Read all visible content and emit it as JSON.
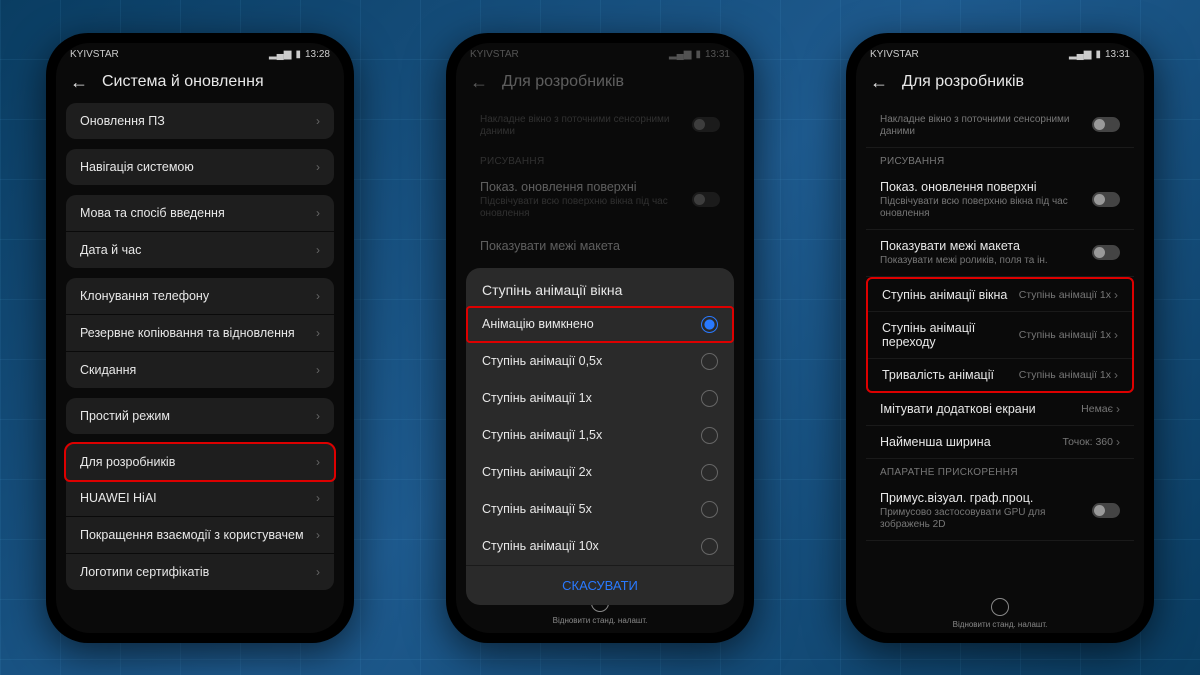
{
  "statusbar": {
    "carrier": "KYIVSTAR",
    "time1": "13:28",
    "time2": "13:31",
    "time3": "13:31"
  },
  "screen1": {
    "title": "Система й оновлення",
    "items": {
      "update": "Оновлення ПЗ",
      "nav": "Навігація системою",
      "lang": "Мова та спосіб введення",
      "date": "Дата й час",
      "clone": "Клонування телефону",
      "backup": "Резервне копіювання та відновлення",
      "reset": "Скидання",
      "simple": "Простий режим",
      "dev": "Для розробників",
      "hiai": "HUAWEI HiAI",
      "ux": "Покращення взаємодії з користувачем",
      "cert": "Логотипи сертифікатів"
    }
  },
  "screen2": {
    "title": "Для розробників",
    "overlay_desc": "Накладне вікно з поточними сенсорними даними",
    "section_draw": "РИСУВАННЯ",
    "surf_title": "Показ. оновлення поверхні",
    "surf_desc": "Підсвічувати всю поверхню вікна під час оновлення",
    "layout_title": "Показувати межі макета",
    "dialog_title": "Ступінь анімації вікна",
    "radios": [
      "Анімацію вимкнено",
      "Ступінь анімації 0,5x",
      "Ступінь анімації 1x",
      "Ступінь анімації 1,5x",
      "Ступінь анімації 2x",
      "Ступінь анімації 5x",
      "Ступінь анімації 10x"
    ],
    "cancel": "СКАСУВАТИ",
    "nav_label": "Відновити станд. налашт."
  },
  "screen3": {
    "title": "Для розробників",
    "overlay_desc": "Накладне вікно з поточними сенсорними даними",
    "section_draw": "РИСУВАННЯ",
    "surf_title": "Показ. оновлення поверхні",
    "surf_desc": "Підсвічувати всю поверхню вікна під час оновлення",
    "layout_title": "Показувати межі макета",
    "layout_desc": "Показувати межі роликів, поля та ін.",
    "anim_window": "Ступінь анімації вікна",
    "anim_window_val": "Ступінь анімації 1x",
    "anim_trans": "Ступінь анімації переходу",
    "anim_trans_val": "Ступінь анімації 1x",
    "anim_dur": "Тривалість анімації",
    "anim_dur_val": "Ступінь анімації 1x",
    "sim_screens": "Імітувати додаткові екрани",
    "sim_screens_val": "Немає",
    "min_width": "Найменша ширина",
    "min_width_val": "Точок: 360",
    "section_hw": "АПАРАТНЕ ПРИСКОРЕННЯ",
    "gpu_title": "Примус.візуал. граф.проц.",
    "gpu_desc": "Примусово застосовувати GPU для зображень 2D",
    "nav_label": "Відновити станд. налашт."
  }
}
